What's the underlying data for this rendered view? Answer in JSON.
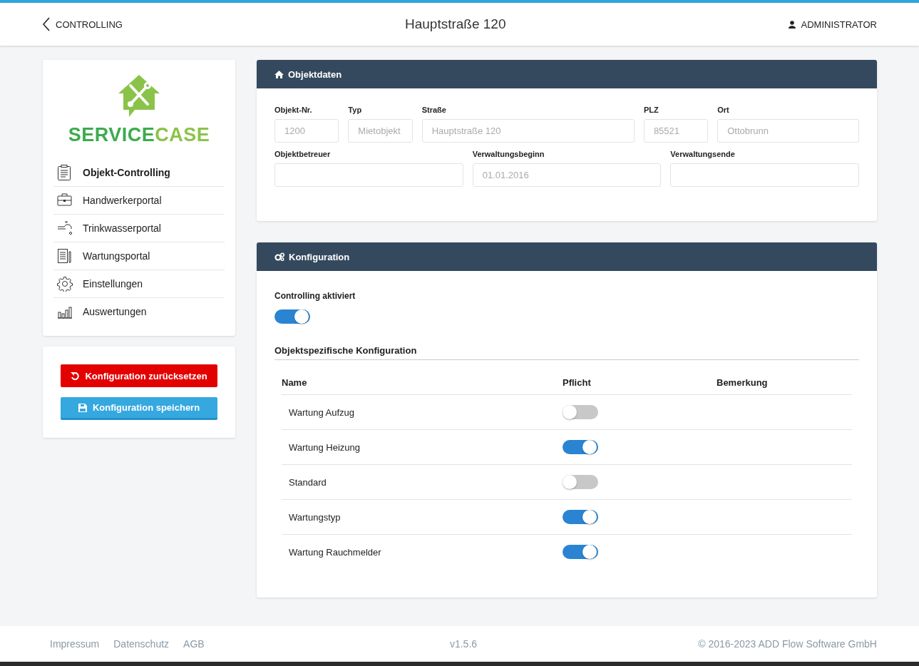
{
  "header": {
    "back_link": "CONTROLLING",
    "title": "Hauptstraße 120",
    "user": "ADMINISTRATOR"
  },
  "sidebar": {
    "logo": {
      "word_1": "SERVICE",
      "word_2": "CASE"
    },
    "items": [
      {
        "label": "Objekt-Controlling",
        "selected": true
      },
      {
        "label": "Handwerkerportal",
        "selected": false
      },
      {
        "label": "Trinkwasserportal",
        "selected": false
      },
      {
        "label": "Wartungsportal",
        "selected": false
      },
      {
        "label": "Einstellungen",
        "selected": false
      },
      {
        "label": "Auswertungen",
        "selected": false
      }
    ]
  },
  "actions": [
    {
      "label": "Konfiguration zurücksetzen",
      "kind": "reset"
    },
    {
      "label": "Konfiguration speichern",
      "kind": "save"
    }
  ],
  "objektdaten": {
    "title": "Objektdaten",
    "rows": [
      [
        {
          "label": "Objekt-Nr.",
          "value": "1200"
        },
        {
          "label": "Typ",
          "value": "Mietobjekt"
        },
        {
          "label": "Straße",
          "value": "Hauptstraße 120"
        },
        {
          "label": "PLZ",
          "value": "85521"
        },
        {
          "label": "Ort",
          "value": "Ottobrunn"
        }
      ],
      [
        {
          "label": "Objektbetreuer"
        },
        {
          "label": "Verwaltungsbeginn",
          "value": "01.01.2016"
        },
        {
          "label": "Verwaltungsende"
        }
      ]
    ]
  },
  "konfiguration": {
    "title": "Konfiguration",
    "controlling_label": "Controlling aktiviert",
    "controlling_on": true,
    "section_title": "Objektspezifische Konfiguration",
    "columns": [
      "Name",
      "Pflicht",
      "Bemerkung"
    ],
    "rows": [
      {
        "name": "Wartung Aufzug",
        "pflicht": false
      },
      {
        "name": "Wartung Heizung",
        "pflicht": true
      },
      {
        "name": "Standard",
        "pflicht": false
      },
      {
        "name": "Wartungstyp",
        "pflicht": true
      },
      {
        "name": "Wartung Rauchmelder",
        "pflicht": true
      }
    ]
  },
  "footer": {
    "links": [
      "Impressum",
      "Datenschutz",
      "AGB"
    ],
    "version": "v1.5.6",
    "copyright": "© 2016-2023 ADD Flow Software GmbH"
  }
}
